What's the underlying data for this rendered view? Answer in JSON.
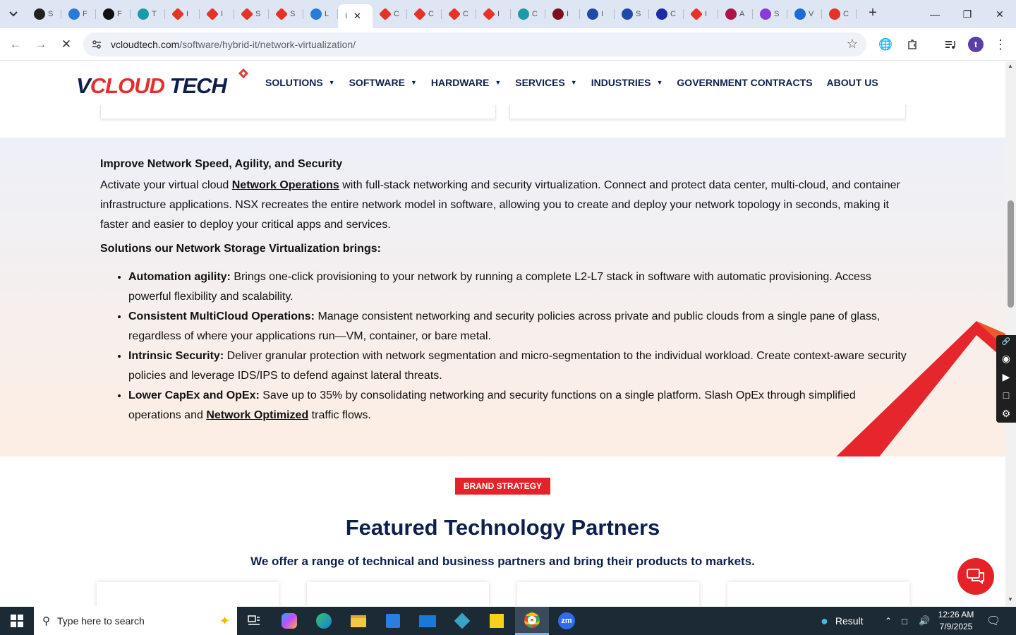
{
  "browser": {
    "tabs": [
      {
        "favicon": "owl-icon",
        "title": "S",
        "color": "#222"
      },
      {
        "favicon": "wave-icon",
        "title": "F",
        "color": "#2b7bd6"
      },
      {
        "favicon": "target-icon",
        "title": "F",
        "color": "#111"
      },
      {
        "favicon": "hexagon-icon",
        "title": "T",
        "color": "#1c9aa8"
      },
      {
        "favicon": "gem-icon",
        "title": "I",
        "color": "#e5332a"
      },
      {
        "favicon": "gem-icon",
        "title": "I",
        "color": "#e5332a"
      },
      {
        "favicon": "gem-icon",
        "title": "S",
        "color": "#e5332a"
      },
      {
        "favicon": "gem-icon",
        "title": "S",
        "color": "#e5332a"
      },
      {
        "favicon": "loading-icon",
        "title": "L",
        "color": "#2b7bd6"
      },
      {
        "favicon": "none",
        "title": "I",
        "color": "#fff",
        "active": true
      },
      {
        "favicon": "gem-icon",
        "title": "C",
        "color": "#e5332a"
      },
      {
        "favicon": "gem-icon",
        "title": "C",
        "color": "#e5332a"
      },
      {
        "favicon": "gem-icon",
        "title": "C",
        "color": "#e5332a"
      },
      {
        "favicon": "gem-icon",
        "title": "I",
        "color": "#e5332a"
      },
      {
        "favicon": "circle-icon",
        "title": "C",
        "color": "#1c9aa8"
      },
      {
        "favicon": "check-icon",
        "title": "I",
        "color": "#7a1020"
      },
      {
        "favicon": "scale-icon",
        "title": "I",
        "color": "#1f4aa8"
      },
      {
        "favicon": "check-icon",
        "title": "S",
        "color": "#1f4aa8"
      },
      {
        "favicon": "x-icon",
        "title": "C",
        "color": "#1f2aa8"
      },
      {
        "favicon": "gem-icon",
        "title": "I",
        "color": "#e5332a"
      },
      {
        "favicon": "dots-icon",
        "title": "A",
        "color": "#b0124a"
      },
      {
        "favicon": "bolt-icon",
        "title": "S",
        "color": "#8a3ad6"
      },
      {
        "favicon": "pulse-icon",
        "title": "V",
        "color": "#1f6ad6"
      },
      {
        "favicon": "swoosh-icon",
        "title": "C",
        "color": "#e5332a"
      }
    ],
    "url_host": "vcloudtech.com",
    "url_path": "/software/hybrid-it/network-virtualization/",
    "profile_initial": "t"
  },
  "site": {
    "logo": {
      "v": "V",
      "cloud": "CLOUD",
      "tech": " TECH"
    },
    "menu": [
      {
        "label": "SOLUTIONS",
        "dropdown": true
      },
      {
        "label": "SOFTWARE",
        "dropdown": true
      },
      {
        "label": "HARDWARE",
        "dropdown": true
      },
      {
        "label": "SERVICES",
        "dropdown": true
      },
      {
        "label": "INDUSTRIES",
        "dropdown": true
      },
      {
        "label": "GOVERNMENT CONTRACTS",
        "dropdown": false
      },
      {
        "label": "ABOUT US",
        "dropdown": false
      }
    ]
  },
  "section": {
    "heading": "Improve Network Speed, Agility, and Security",
    "intro_pre": " Activate your virtual cloud ",
    "intro_link": "Network Operations",
    "intro_post": " with full-stack networking and security virtualization. Connect and protect data center, multi-cloud, and container infrastructure applications. NSX recreates the entire network model in software, allowing you to create and deploy your network topology in seconds, making it faster and easier to deploy your critical apps and services.",
    "subheading": "Solutions our Network Storage Virtualization brings:",
    "bullets": [
      {
        "bold": "Automation agility:",
        "text": " Brings one-click provisioning to your network by running a complete L2-L7 stack in software with automatic provisioning. Access powerful flexibility and scalability."
      },
      {
        "bold": "Consistent MultiCloud Operations:",
        "text": " Manage consistent networking and security policies across private and public clouds from a single pane of glass, regardless of where your applications run—VM, container, or bare metal."
      },
      {
        "bold": "Intrinsic Security:",
        "text": " Deliver granular protection with network segmentation and micro-segmentation to the individual workload. Create context-aware security policies and leverage IDS/IPS to defend against lateral threats."
      },
      {
        "bold": "Lower CapEx and OpEx:",
        "text": " Save up to 35% by consolidating networking and security functions on a single platform. Slash OpEx through simplified operations and ",
        "link": "Network Optimized",
        "text_after": " traffic flows."
      }
    ]
  },
  "partners": {
    "badge": "BRAND STRATEGY",
    "title": "Featured Technology Partners",
    "lead": "We offer a range of technical and business partners and bring their products to markets."
  },
  "taskbar": {
    "search_placeholder": "Type here to search",
    "weather_label": "Result",
    "time": "12:26 AM",
    "date": "7/9/2025"
  },
  "colors": {
    "brand_navy": "#0d1f4c",
    "brand_red": "#e52228"
  }
}
